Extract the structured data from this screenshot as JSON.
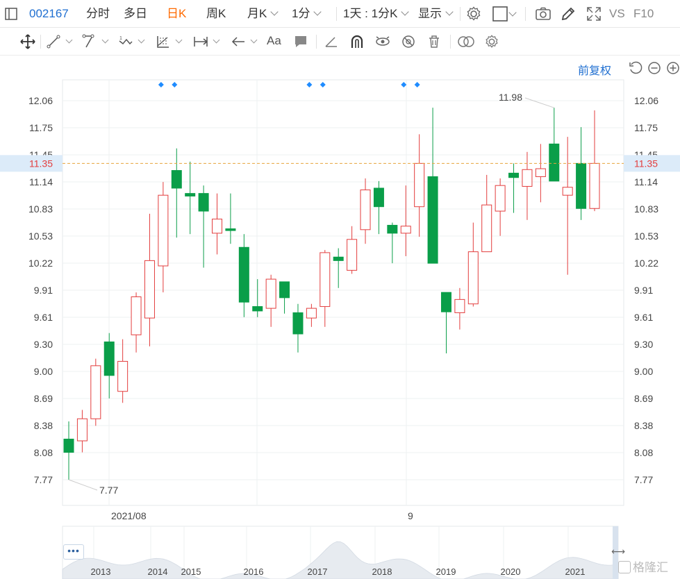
{
  "toolbar": {
    "code": "002167",
    "tabs": [
      {
        "label": "分时",
        "active": false
      },
      {
        "label": "多日",
        "active": false
      },
      {
        "label": "日K",
        "active": true
      },
      {
        "label": "周K",
        "active": false
      },
      {
        "label": "月K",
        "active": false
      }
    ],
    "interval": "1分",
    "mode": "1天 : 1分K",
    "display": "显示",
    "vs": "VS",
    "f10": "F10"
  },
  "chart_header": {
    "adjust": "前复权"
  },
  "chart_data": {
    "type": "candlestick",
    "y_ticks": [
      "12.06",
      "11.75",
      "11.45",
      "11.14",
      "10.83",
      "10.53",
      "10.22",
      "9.91",
      "9.61",
      "9.30",
      "9.00",
      "8.69",
      "8.38",
      "8.08",
      "7.77"
    ],
    "ylim": [
      7.62,
      12.36
    ],
    "current_price": "11.35",
    "max_label": "11.98",
    "min_label": "7.77",
    "x_labels": [
      "2021/08",
      "9"
    ],
    "candles": [
      {
        "o": 8.23,
        "c": 8.08,
        "h": 8.43,
        "l": 7.77
      },
      {
        "o": 8.21,
        "c": 8.46,
        "h": 8.56,
        "l": 8.08
      },
      {
        "o": 8.46,
        "c": 9.06,
        "h": 9.14,
        "l": 8.38
      },
      {
        "o": 9.33,
        "c": 8.95,
        "h": 9.43,
        "l": 8.69
      },
      {
        "o": 8.77,
        "c": 9.11,
        "h": 9.36,
        "l": 8.64
      },
      {
        "o": 9.41,
        "c": 9.84,
        "h": 9.89,
        "l": 9.21
      },
      {
        "o": 9.6,
        "c": 10.25,
        "h": 10.78,
        "l": 9.28
      },
      {
        "o": 10.19,
        "c": 10.99,
        "h": 11.14,
        "l": 9.89
      },
      {
        "o": 11.27,
        "c": 11.07,
        "h": 11.52,
        "l": 10.51
      },
      {
        "o": 11.01,
        "c": 10.98,
        "h": 11.37,
        "l": 10.55
      },
      {
        "o": 11.01,
        "c": 10.81,
        "h": 11.1,
        "l": 10.17
      },
      {
        "o": 10.56,
        "c": 10.72,
        "h": 11.01,
        "l": 10.32
      },
      {
        "o": 10.61,
        "c": 10.59,
        "h": 11.01,
        "l": 10.44
      },
      {
        "o": 10.4,
        "c": 9.78,
        "h": 10.55,
        "l": 9.61
      },
      {
        "o": 9.73,
        "c": 9.68,
        "h": 10.04,
        "l": 9.61
      },
      {
        "o": 9.71,
        "c": 10.04,
        "h": 10.09,
        "l": 9.5
      },
      {
        "o": 10.01,
        "c": 9.83,
        "h": 10.01,
        "l": 9.65
      },
      {
        "o": 9.66,
        "c": 9.42,
        "h": 9.76,
        "l": 9.21
      },
      {
        "o": 9.6,
        "c": 9.71,
        "h": 9.76,
        "l": 9.5
      },
      {
        "o": 9.73,
        "c": 10.34,
        "h": 10.37,
        "l": 9.5
      },
      {
        "o": 10.29,
        "c": 10.25,
        "h": 10.39,
        "l": 9.94
      },
      {
        "o": 10.14,
        "c": 10.49,
        "h": 10.64,
        "l": 10.1
      },
      {
        "o": 10.6,
        "c": 11.05,
        "h": 11.18,
        "l": 10.44
      },
      {
        "o": 11.07,
        "c": 10.86,
        "h": 11.15,
        "l": 10.55
      },
      {
        "o": 10.65,
        "c": 10.56,
        "h": 10.68,
        "l": 10.22
      },
      {
        "o": 10.56,
        "c": 10.64,
        "h": 11.1,
        "l": 10.3
      },
      {
        "o": 10.86,
        "c": 11.35,
        "h": 11.68,
        "l": 10.52
      },
      {
        "o": 11.2,
        "c": 10.22,
        "h": 11.98,
        "l": 10.22
      },
      {
        "o": 9.89,
        "c": 9.67,
        "h": 9.89,
        "l": 9.2
      },
      {
        "o": 9.66,
        "c": 9.81,
        "h": 9.94,
        "l": 9.47
      },
      {
        "o": 9.76,
        "c": 10.35,
        "h": 10.68,
        "l": 9.73
      },
      {
        "o": 10.35,
        "c": 10.88,
        "h": 11.22,
        "l": 10.35
      },
      {
        "o": 10.81,
        "c": 11.1,
        "h": 11.18,
        "l": 10.53
      },
      {
        "o": 11.24,
        "c": 11.19,
        "h": 11.35,
        "l": 10.79
      },
      {
        "o": 11.09,
        "c": 11.28,
        "h": 11.48,
        "l": 10.71
      },
      {
        "o": 11.2,
        "c": 11.29,
        "h": 11.57,
        "l": 10.91
      },
      {
        "o": 11.57,
        "c": 11.15,
        "h": 11.98,
        "l": 11.15
      },
      {
        "o": 10.99,
        "c": 11.08,
        "h": 11.65,
        "l": 10.09
      },
      {
        "o": 11.35,
        "c": 10.84,
        "h": 11.76,
        "l": 10.71
      },
      {
        "o": 10.84,
        "c": 11.35,
        "h": 11.95,
        "l": 10.81
      }
    ],
    "markers_at": [
      7,
      8,
      18,
      19,
      25,
      26
    ],
    "overview_years": [
      "2013",
      "2014",
      "2015",
      "2016",
      "2017",
      "2018",
      "2019",
      "2020",
      "2021"
    ],
    "colors": {
      "up": "#e33d3d",
      "down": "#0a9e49",
      "grid": "#eef0f2",
      "marker": "#1f8cff",
      "price_line": "#e8a33a"
    }
  },
  "overview": {
    "more": "•••"
  },
  "watermark": "格隆汇"
}
